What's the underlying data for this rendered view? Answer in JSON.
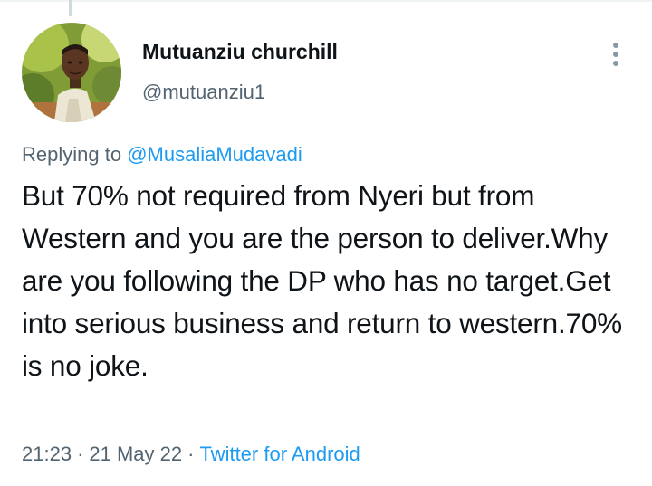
{
  "author": {
    "display_name": "Mutuanziu churchill",
    "handle": "@mutuanziu1",
    "avatar_icon": "user-photo-avatar"
  },
  "reply": {
    "prefix": "Replying to",
    "mention": "@MusaliaMudavadi"
  },
  "tweet": {
    "text": "But 70% not required from Nyeri but from Western and you are the person to deliver.Why are you following the DP who has no target.Get into serious business and return to western.70% is no joke."
  },
  "meta": {
    "time": "21:23",
    "separator": "·",
    "date": "21 May 22",
    "source": "Twitter for Android"
  },
  "menu": {
    "icon": "more-vertical-icon"
  },
  "colors": {
    "text_primary": "#0f1419",
    "text_secondary": "#536471",
    "accent": "#1d9bf0"
  }
}
